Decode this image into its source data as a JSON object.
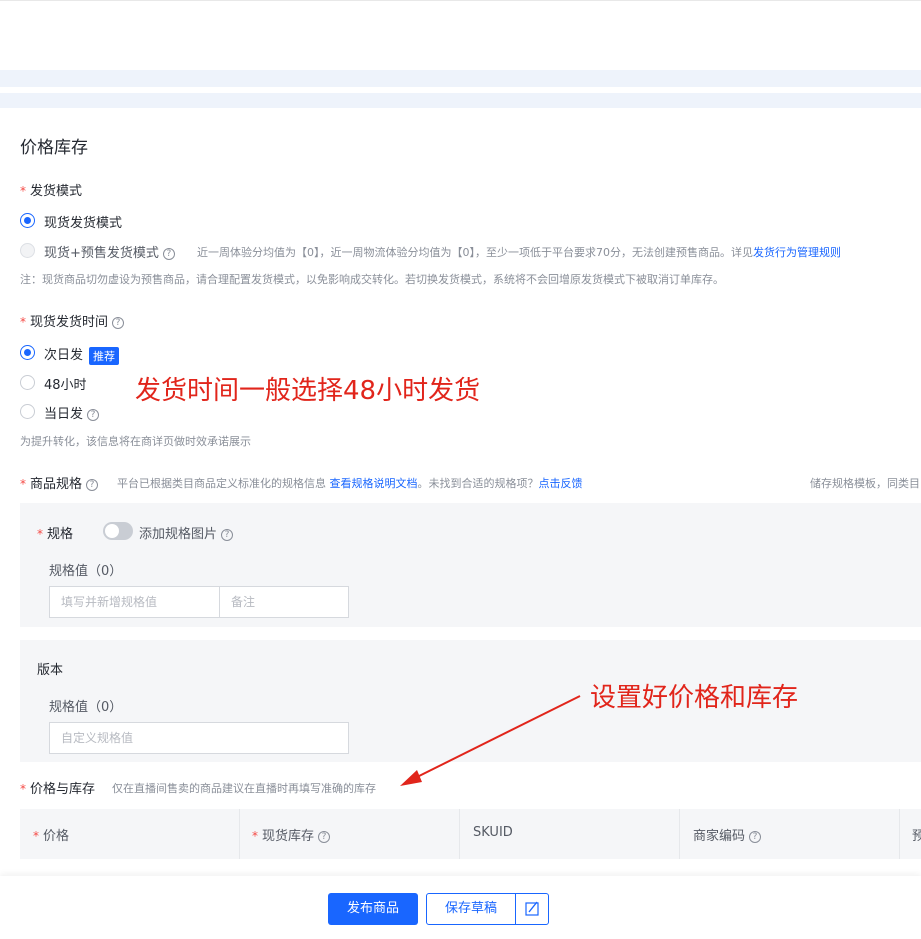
{
  "section_title": "价格库存",
  "shipping_mode": {
    "label": "发货模式",
    "option1": "现货发货模式",
    "option2": "现货+预售发货模式",
    "option2_hint_prefix": "近一周体验分均值为【0】，近一周物流体验分均值为【0】，至少一项低于平台要求70分，无法创建预售商品。详见",
    "option2_hint_link": "发货行为管理规则",
    "note": "注：现货商品切勿虚设为预售商品，请合理配置发货模式，以免影响成交转化。若切换发货模式，系统将不会回增原发货模式下被取消订单库存。"
  },
  "ship_time": {
    "label": "现货发货时间",
    "option1": "次日发",
    "option1_badge": "推荐",
    "option2": "48小时",
    "option3": "当日发",
    "note": "为提升转化，该信息将在商详页做时效承诺展示"
  },
  "annotation1": "发货时间一般选择48小时发货",
  "annotation2": "设置好价格和库存",
  "spec": {
    "label": "商品规格",
    "hint": "平台已根据类目商品定义标准化的规格信息",
    "link1": "查看规格说明文档",
    "hint2": "。未找到合适的规格项？",
    "link2": "点击反馈",
    "right_text": "储存规格模板，同类目",
    "panel1": {
      "label": "规格",
      "toggle_label": "添加规格图片",
      "values_label": "规格值（0）",
      "input_placeholder": "填写并新增规格值",
      "note_placeholder": "备注"
    },
    "panel2": {
      "label": "版本",
      "values_label": "规格值（0）",
      "input_placeholder": "自定义规格值"
    }
  },
  "price_stock": {
    "label": "价格与库存",
    "hint": "仅在直播间售卖的商品建议在直播时再填写准确的库存",
    "columns": [
      "价格",
      "现货库存",
      "SKUID",
      "商家编码",
      "预"
    ]
  },
  "footer": {
    "publish": "发布商品",
    "save_draft": "保存草稿"
  }
}
